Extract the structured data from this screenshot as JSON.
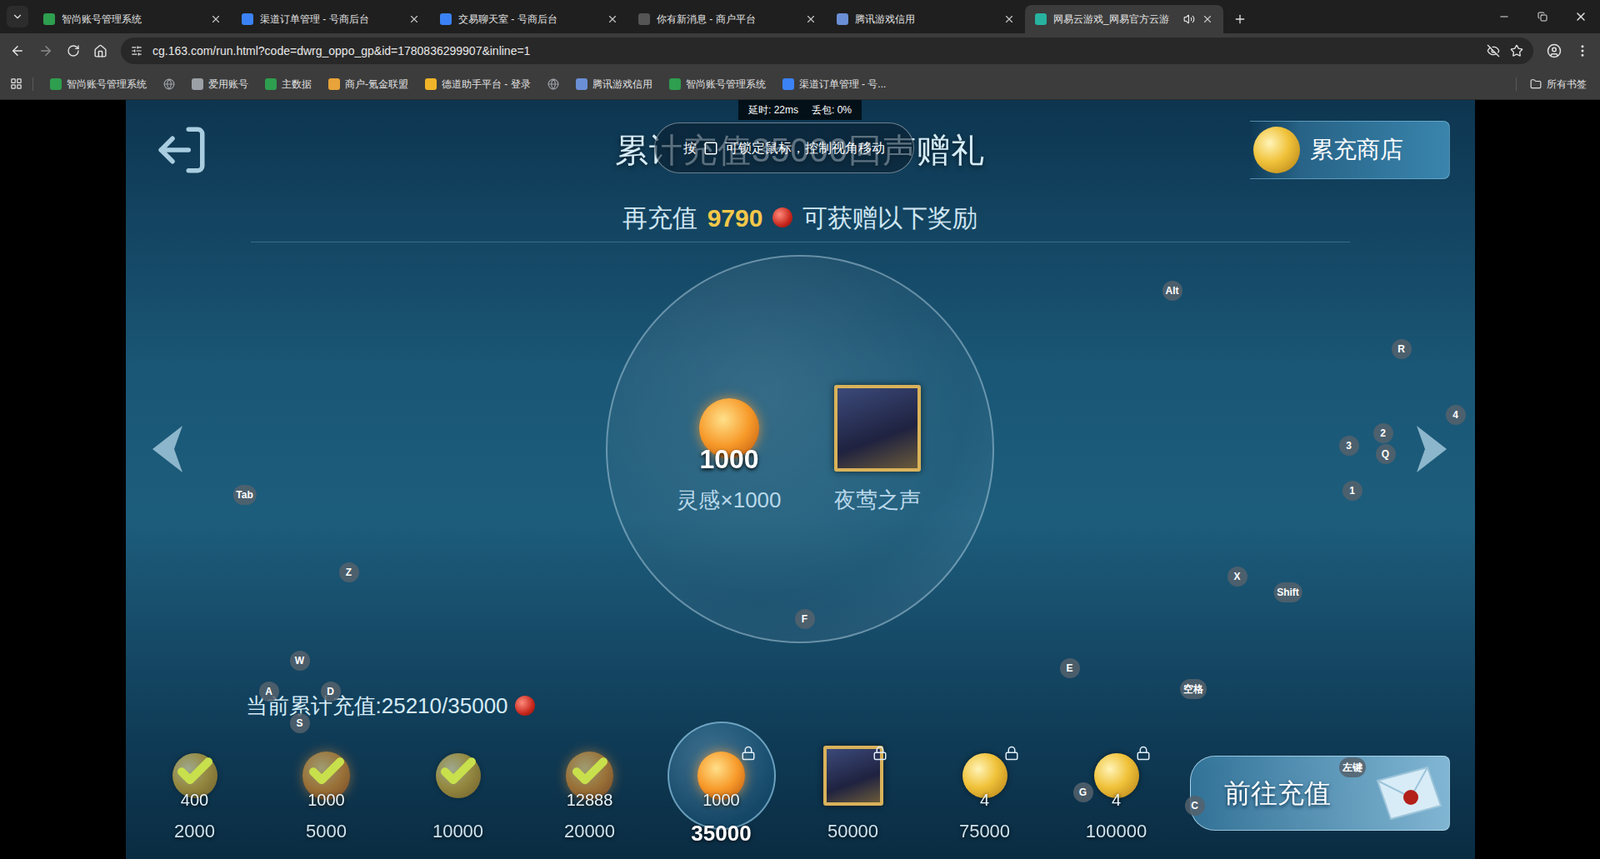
{
  "browser": {
    "tabs": [
      {
        "title": "智尚账号管理系统",
        "selected": false,
        "audio": false,
        "color": "#2e9e4f"
      },
      {
        "title": "渠道订单管理 - 号商后台",
        "selected": false,
        "audio": false,
        "color": "#3b82f6"
      },
      {
        "title": "交易聊天室 - 号商后台",
        "selected": false,
        "audio": false,
        "color": "#3b82f6"
      },
      {
        "title": "你有新消息 - 商户平台",
        "selected": false,
        "audio": false,
        "color": "#555555"
      },
      {
        "title": "腾讯游戏信用",
        "selected": false,
        "audio": false,
        "color": "#6b8fd6"
      },
      {
        "title": "网易云游戏_网易官方云游",
        "selected": true,
        "audio": true,
        "color": "#27b3a0"
      }
    ],
    "url": "cg.163.com/run.html?code=dwrg_oppo_gp&id=1780836299907&inline=1",
    "bookmarks": [
      {
        "label": "智尚账号管理系统",
        "color": "#2e9e4f"
      },
      {
        "label": "",
        "color": "#9aa0a6"
      },
      {
        "label": "爱用账号",
        "color": "#9aa0a6"
      },
      {
        "label": "主数据",
        "color": "#2e9e4f"
      },
      {
        "label": "商户-氪金联盟",
        "color": "#e8a33a"
      },
      {
        "label": "德道助手平台 - 登录",
        "color": "#f0b429"
      },
      {
        "label": "",
        "color": "#9aa0a6"
      },
      {
        "label": "腾讯游戏信用",
        "color": "#6b8fd6"
      },
      {
        "label": "智尚账号管理系统",
        "color": "#2e9e4f"
      },
      {
        "label": "渠道订单管理 - 号...",
        "color": "#3b82f6"
      }
    ],
    "all_bookmarks": "所有书签"
  },
  "game": {
    "status": {
      "latency": "延时: 22ms",
      "loss": "丢包: 0%"
    },
    "hint": {
      "before": "按",
      "after": "可锁定鼠标，控制视角移动"
    },
    "title": "累计充值35000回声赠礼",
    "store_button": "累充商店",
    "need": {
      "prefix": "再充值",
      "amount": "9790",
      "suffix": "可获赠以下奖励"
    },
    "rewards": [
      {
        "name": "灵感×1000",
        "amount": "1000",
        "kind": "inspiration"
      },
      {
        "name": "夜莺之声",
        "amount": "",
        "kind": "card"
      }
    ],
    "progress": {
      "label": "当前累计充值:",
      "value": "25210/35000"
    },
    "milestones": [
      {
        "target": "2000",
        "amount": "400",
        "kind": "coin",
        "done": true,
        "locked": false,
        "current": false
      },
      {
        "target": "5000",
        "amount": "1000",
        "kind": "inspiration",
        "done": true,
        "locked": false,
        "current": false
      },
      {
        "target": "10000",
        "amount": "",
        "kind": "coin",
        "done": true,
        "locked": false,
        "current": false
      },
      {
        "target": "20000",
        "amount": "12888",
        "kind": "inspiration",
        "done": true,
        "locked": false,
        "current": false
      },
      {
        "target": "35000",
        "amount": "1000",
        "kind": "inspiration",
        "done": false,
        "locked": true,
        "current": true
      },
      {
        "target": "50000",
        "amount": "",
        "kind": "card",
        "done": false,
        "locked": true,
        "current": false
      },
      {
        "target": "75000",
        "amount": "4",
        "kind": "coin",
        "done": false,
        "locked": true,
        "current": false
      },
      {
        "target": "100000",
        "amount": "4",
        "kind": "coin",
        "done": false,
        "locked": true,
        "current": false
      }
    ],
    "recharge_button": "前往充值",
    "keys": [
      "Alt",
      "R",
      "4",
      "2",
      "3",
      "Q",
      "1",
      "Tab",
      "X",
      "Shift",
      "Z",
      "F",
      "W",
      "E",
      "A",
      "D",
      "S",
      "空格",
      "G",
      "C",
      "左键"
    ]
  }
}
